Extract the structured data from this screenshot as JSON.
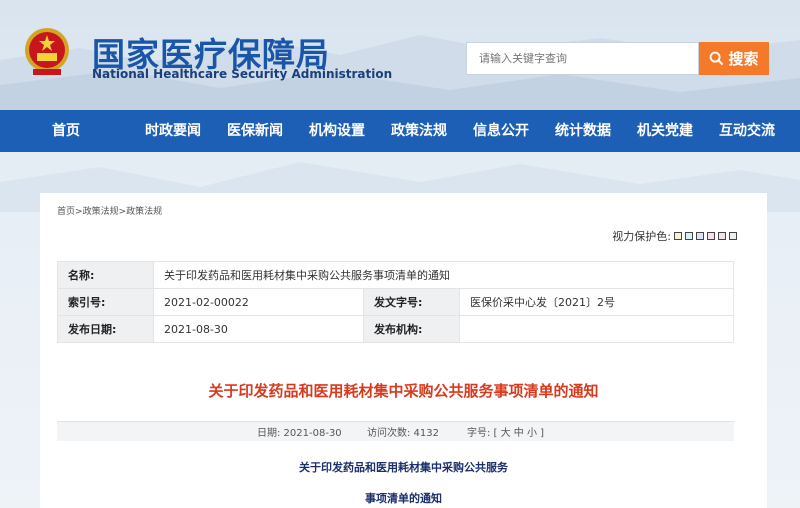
{
  "header": {
    "site_name_cn": "国家医疗保障局",
    "site_name_en": "National Healthcare Security Administration",
    "search_placeholder": "请输入关键字查询",
    "search_button": "搜索"
  },
  "nav": {
    "items": [
      "首页",
      "时政要闻",
      "医保新闻",
      "机构设置",
      "政策法规",
      "信息公开",
      "统计数据",
      "机关党建",
      "互动交流"
    ]
  },
  "breadcrumb": {
    "items": [
      "首页",
      "政策法规",
      "政策法规"
    ],
    "separator": ">"
  },
  "color_protect": {
    "label": "视力保护色:",
    "swatches": [
      "#f7f3d0",
      "#d9f0f7",
      "#dde3f7",
      "#f7dff0",
      "#f0e6e6",
      "#eeeeee"
    ]
  },
  "info": {
    "name_label": "名称:",
    "name_value": "关于印发药品和医用耗材集中采购公共服务事项清单的通知",
    "index_label": "索引号:",
    "index_value": "2021-02-00022",
    "docno_label": "发文字号:",
    "docno_value": "医保价采中心发〔2021〕2号",
    "date_label": "发布日期:",
    "date_value": "2021-08-30",
    "org_label": "发布机构:",
    "org_value": ""
  },
  "article": {
    "title": "关于印发药品和医用耗材集中采购公共服务事项清单的通知",
    "meta_date": "日期: 2021-08-30",
    "meta_visits": "访问次数: 4132",
    "meta_fontsize": "字号: [ 大 中 小 ]",
    "subtitle_line1": "关于印发药品和医用耗材集中采购公共服务",
    "subtitle_line2": "事项清单的通知"
  }
}
